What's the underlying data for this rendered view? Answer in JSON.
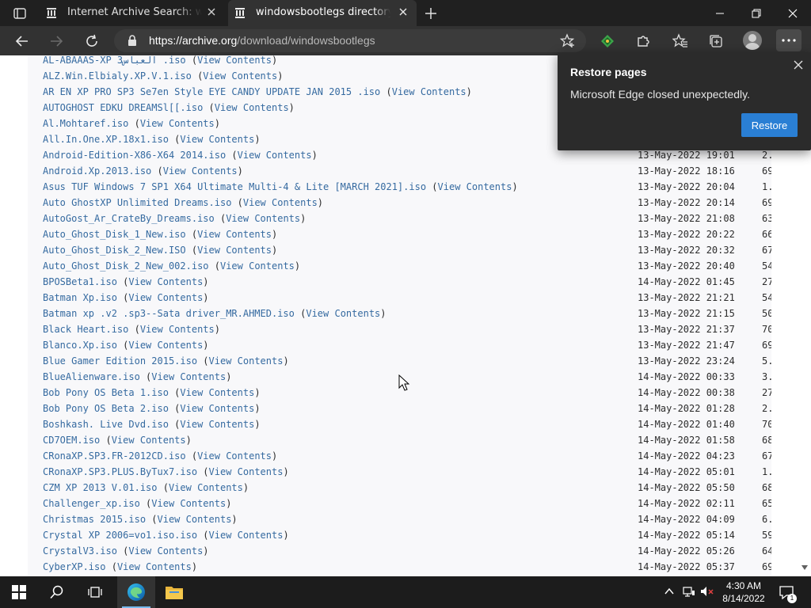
{
  "browser": {
    "tabs": [
      {
        "title": "Internet Archive Search: windows",
        "active": false
      },
      {
        "title": "windowsbootlegs directory listing",
        "active": true
      }
    ],
    "url_host": "https://archive.org",
    "url_path": "/download/windowsbootlegs"
  },
  "restore_popup": {
    "title": "Restore pages",
    "message": "Microsoft Edge closed unexpectedly.",
    "button": "Restore"
  },
  "listing": {
    "view_label": "View Contents",
    "rows": [
      {
        "name": "AL-ABAAAS-XP  العباس3 .iso",
        "date": "",
        "size": ""
      },
      {
        "name": "ALZ.Win.Elbialy.XP.V.1.iso",
        "date": "",
        "size": ""
      },
      {
        "name": "AR EN XP PRO SP3  Se7en  Style EYE CANDY UPDATE JAN 2015 .iso",
        "date": "",
        "size": ""
      },
      {
        "name": "AUTOGHOST EDKU DREAMSl[[.iso",
        "date": "",
        "size": ""
      },
      {
        "name": "Al.Mohtaref.iso",
        "date": "",
        "size": ""
      },
      {
        "name": "All.In.One.XP.18x1.iso",
        "date": "",
        "size": ""
      },
      {
        "name": "Android-Edition-X86-X64 2014.iso",
        "date": "13-May-2022 19:01",
        "size": "2."
      },
      {
        "name": "Android.Xp.2013.iso",
        "date": "13-May-2022 18:16",
        "size": "69"
      },
      {
        "name": "Asus TUF Windows 7 SP1 X64 Ultimate Multi-4 & Lite [MARCH 2021].iso",
        "date": "13-May-2022 20:04",
        "size": "1."
      },
      {
        "name": "Auto GhostXP Unlimited Dreams.iso",
        "date": "13-May-2022 20:14",
        "size": "69"
      },
      {
        "name": "AutoGost_Ar_CrateBy_Dreams.iso",
        "date": "13-May-2022 21:08",
        "size": "63"
      },
      {
        "name": "Auto_Ghost_Disk_1_New.iso",
        "date": "13-May-2022 20:22",
        "size": "66"
      },
      {
        "name": "Auto_Ghost_Disk_2_New.ISO",
        "date": "13-May-2022 20:32",
        "size": "67"
      },
      {
        "name": "Auto_Ghost_Disk_2_New_002.iso",
        "date": "13-May-2022 20:40",
        "size": "54"
      },
      {
        "name": "BPOSBeta1.iso",
        "date": "14-May-2022 01:45",
        "size": "27"
      },
      {
        "name": "Batman Xp.iso",
        "date": "13-May-2022 21:21",
        "size": "54"
      },
      {
        "name": "Batman xp .v2 .sp3--Sata driver_MR.AHMED.iso",
        "date": "13-May-2022 21:15",
        "size": "50"
      },
      {
        "name": "Black Heart.iso",
        "date": "13-May-2022 21:37",
        "size": "70"
      },
      {
        "name": "Blanco.Xp.iso",
        "date": "13-May-2022 21:47",
        "size": "69"
      },
      {
        "name": "Blue Gamer Edition 2015.iso",
        "date": "13-May-2022 23:24",
        "size": "5."
      },
      {
        "name": "BlueAlienware.iso",
        "date": "14-May-2022 00:33",
        "size": "3."
      },
      {
        "name": "Bob Pony OS Beta 1.iso",
        "date": "14-May-2022 00:38",
        "size": "27"
      },
      {
        "name": "Bob Pony OS Beta 2.iso",
        "date": "14-May-2022 01:28",
        "size": "2."
      },
      {
        "name": "Boshkash. Live Dvd.iso",
        "date": "14-May-2022 01:40",
        "size": "70"
      },
      {
        "name": "CD7OEM.iso",
        "date": "14-May-2022 01:58",
        "size": "68"
      },
      {
        "name": "CRonaXP.SP3.FR-2012CD.iso",
        "date": "14-May-2022 04:23",
        "size": "67"
      },
      {
        "name": "CRonaXP.SP3.PLUS.ByTux7.iso",
        "date": "14-May-2022 05:01",
        "size": "1."
      },
      {
        "name": "CZM XP 2013 V.01.iso",
        "date": "14-May-2022 05:50",
        "size": "68"
      },
      {
        "name": "Challenger_xp.iso",
        "date": "14-May-2022 02:11",
        "size": "65"
      },
      {
        "name": "Christmas 2015.iso",
        "date": "14-May-2022 04:09",
        "size": "6."
      },
      {
        "name": "Crystal XP 2006=vo1.iso.iso",
        "date": "14-May-2022 05:14",
        "size": "59"
      },
      {
        "name": "CrystalV3.iso",
        "date": "14-May-2022 05:26",
        "size": "64"
      },
      {
        "name": "CyberXP.iso",
        "date": "14-May-2022 05:37",
        "size": "69"
      }
    ]
  },
  "taskbar": {
    "time": "4:30 AM",
    "date": "8/14/2022",
    "notification_count": "1"
  },
  "colors": {
    "link": "#356aa0",
    "accent": "#2a7fd4",
    "chrome_dark": "#202020"
  }
}
